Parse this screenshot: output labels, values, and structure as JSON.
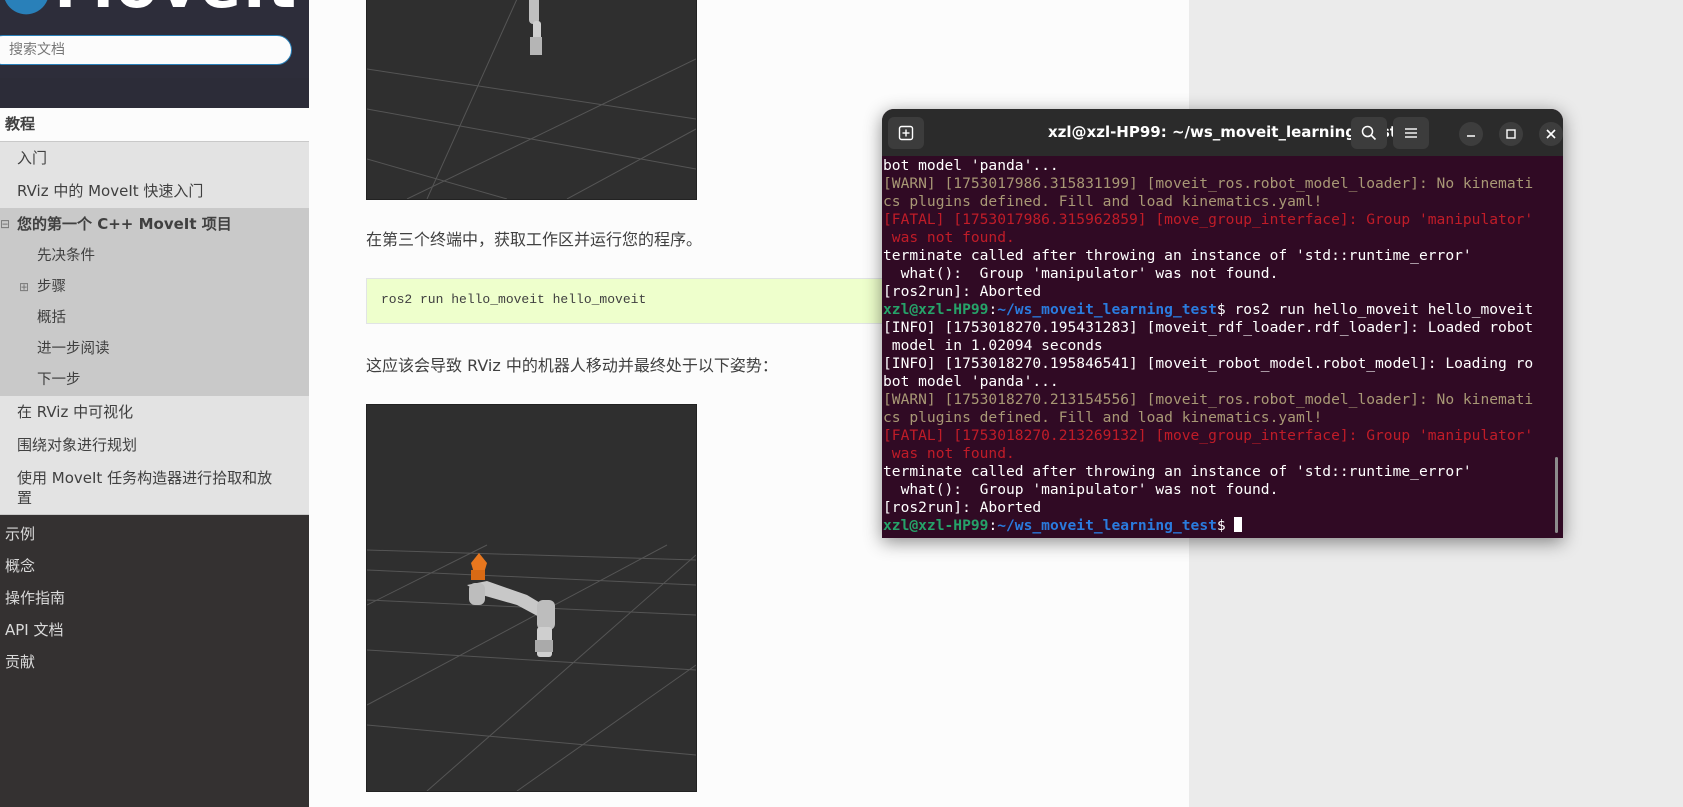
{
  "sidebar": {
    "logo": "MoveIt",
    "search_placeholder": "搜索文档",
    "caption": "教程",
    "items": {
      "getting_started": "入门",
      "rviz_quickstart": "RViz 中的 MoveIt 快速入门",
      "first_cpp_project": "您的第一个 C++ MoveIt 项目",
      "prerequisites": "先决条件",
      "steps": "步骤",
      "summary": "概括",
      "further_reading": "进一步阅读",
      "next_step": "下一步",
      "visualizing_in_rviz": "在 RViz 中可视化",
      "planning_around_objects": "围绕对象进行规划",
      "pick_and_place": "使用 MoveIt 任务构造器进行拾取和放置"
    },
    "sections": [
      "示例",
      "概念",
      "操作指南",
      "API 文档",
      "贡献"
    ]
  },
  "main": {
    "para1": "在第三个终端中，获取工作区并运行您的程序。",
    "code": "ros2 run hello_moveit hello_moveit",
    "para2": "这应该会导致 RViz 中的机器人移动并最终处于以下姿势："
  },
  "terminal": {
    "title": "xzl@xzl-HP99: ~/ws_moveit_learning_test",
    "prompt_user": "xzl@xzl-HP99",
    "prompt_path": "~/ws_moveit_learning_test",
    "command": "ros2 run hello_moveit hello_moveit",
    "lines": [
      "bot model 'panda'...",
      "[WARN] [1753017986.315831199] [moveit_ros.robot_model_loader]: No kinemati",
      "cs plugins defined. Fill and load kinematics.yaml!",
      "[FATAL] [1753017986.315962859] [move_group_interface]: Group 'manipulator'",
      " was not found.",
      "terminate called after throwing an instance of 'std::runtime_error'",
      "  what():  Group 'manipulator' was not found.",
      "[ros2run]: Aborted",
      "[INFO] [1753018270.195431283] [moveit_rdf_loader.rdf_loader]: Loaded robot",
      " model in 1.02094 seconds",
      "[INFO] [1753018270.195846541] [moveit_robot_model.robot_model]: Loading ro",
      "bot model 'panda'...",
      "[WARN] [1753018270.213154556] [moveit_ros.robot_model_loader]: No kinemati",
      "cs plugins defined. Fill and load kinematics.yaml!",
      "[FATAL] [1753018270.213269132] [move_group_interface]: Group 'manipulator'",
      " was not found.",
      "terminate called after throwing an instance of 'std::runtime_error'",
      "  what():  Group 'manipulator' was not found.",
      "[ros2run]: Aborted"
    ]
  },
  "colors": {
    "sidebar_bg": "#343131",
    "terminal_bg": "#300a24",
    "code_bg": "#eeffcc",
    "warn": "#a89875",
    "fatal": "#c01c28",
    "prompt_user": "#26a269",
    "prompt_path": "#2a7bde",
    "robot_gripper": "#e8771e"
  }
}
